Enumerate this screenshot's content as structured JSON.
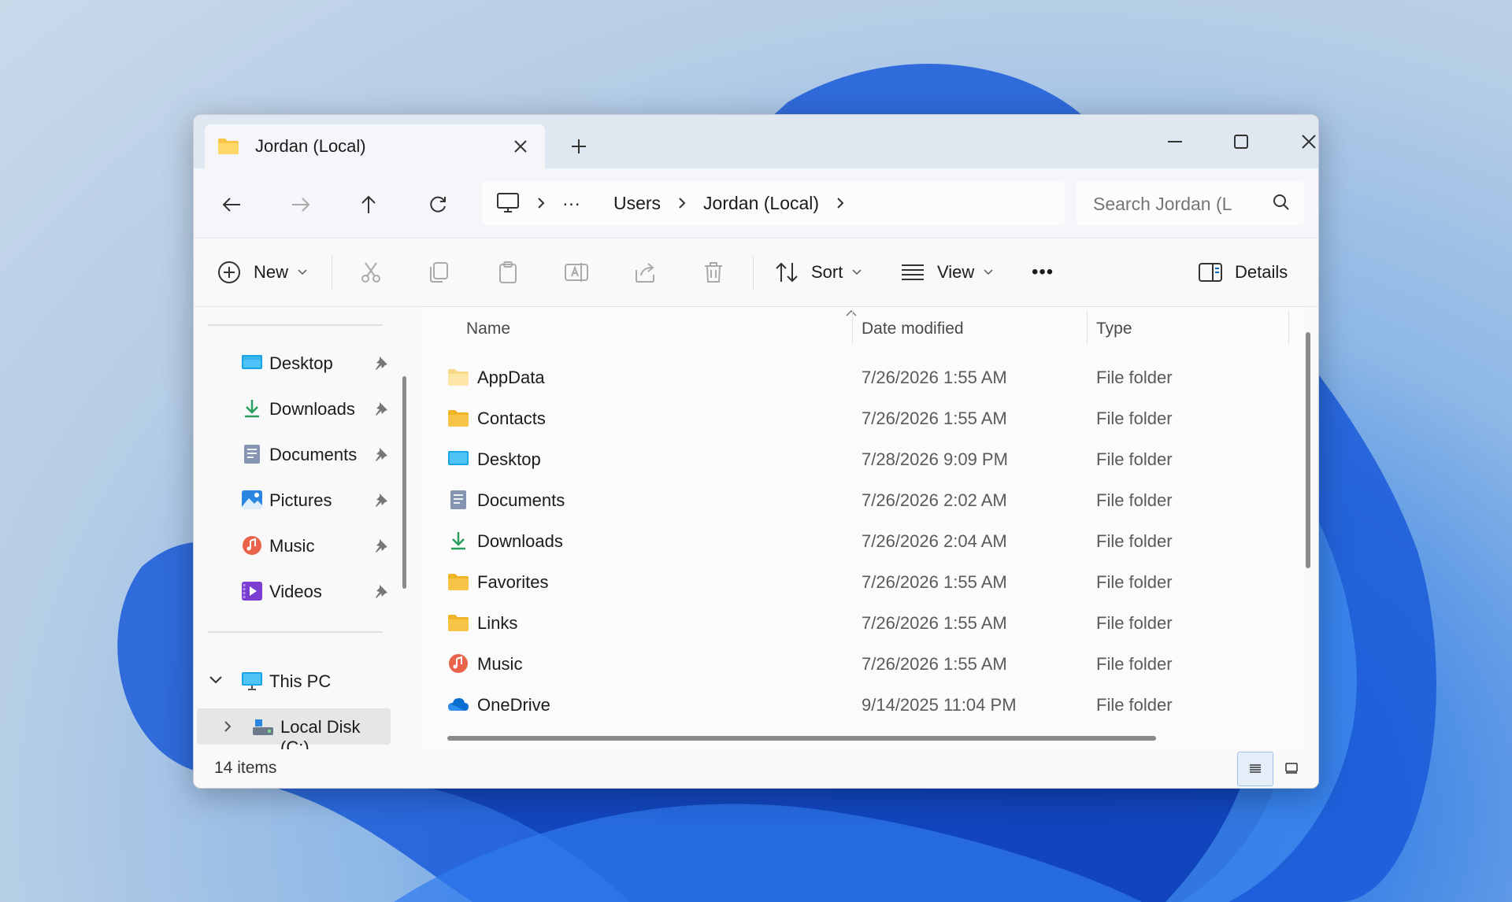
{
  "window": {
    "tab_title": "Jordan (Local)"
  },
  "address": {
    "crumbs": [
      "Users",
      "Jordan (Local)"
    ],
    "overflow": "···",
    "search_placeholder": "Search Jordan (L"
  },
  "toolbar": {
    "new_label": "New",
    "sort_label": "Sort",
    "view_label": "View",
    "more_label": "•••",
    "details_label": "Details"
  },
  "sidebar": {
    "quick_access": [
      {
        "label": "Desktop",
        "icon": "desktop-icon"
      },
      {
        "label": "Downloads",
        "icon": "downloads-icon"
      },
      {
        "label": "Documents",
        "icon": "documents-icon"
      },
      {
        "label": "Pictures",
        "icon": "pictures-icon"
      },
      {
        "label": "Music",
        "icon": "music-icon"
      },
      {
        "label": "Videos",
        "icon": "videos-icon"
      }
    ],
    "this_pc": "This PC",
    "local_disk": "Local Disk (C:)"
  },
  "columns": {
    "name": "Name",
    "date": "Date modified",
    "type": "Type"
  },
  "files": [
    {
      "name": "AppData",
      "date": "7/26/2026 1:55 AM",
      "type": "File folder",
      "icon": "folder-light-icon"
    },
    {
      "name": "Contacts",
      "date": "7/26/2026 1:55 AM",
      "type": "File folder",
      "icon": "folder-icon"
    },
    {
      "name": "Desktop",
      "date": "7/28/2026 9:09 PM",
      "type": "File folder",
      "icon": "desktop-icon"
    },
    {
      "name": "Documents",
      "date": "7/26/2026 2:02 AM",
      "type": "File folder",
      "icon": "documents-icon"
    },
    {
      "name": "Downloads",
      "date": "7/26/2026 2:04 AM",
      "type": "File folder",
      "icon": "downloads-icon"
    },
    {
      "name": "Favorites",
      "date": "7/26/2026 1:55 AM",
      "type": "File folder",
      "icon": "folder-icon"
    },
    {
      "name": "Links",
      "date": "7/26/2026 1:55 AM",
      "type": "File folder",
      "icon": "folder-icon"
    },
    {
      "name": "Music",
      "date": "7/26/2026 1:55 AM",
      "type": "File folder",
      "icon": "music-icon"
    },
    {
      "name": "OneDrive",
      "date": "9/14/2025 11:04 PM",
      "type": "File folder",
      "icon": "onedrive-icon"
    }
  ],
  "status": {
    "item_count": "14 items"
  },
  "colors": {
    "accent": "#0067c0",
    "folder": "#f8c447",
    "titlebar": "#dfe7f1"
  }
}
